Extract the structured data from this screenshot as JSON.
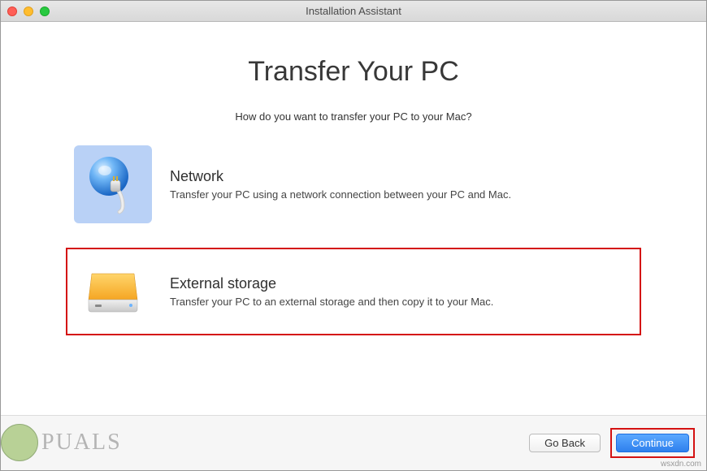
{
  "window": {
    "title": "Installation Assistant"
  },
  "page": {
    "title": "Transfer Your PC",
    "subtitle": "How do you want to transfer your PC to your Mac?"
  },
  "options": {
    "network": {
      "title": "Network",
      "description": "Transfer your PC using a network connection between your PC and Mac."
    },
    "external": {
      "title": "External storage",
      "description": "Transfer your PC to an external storage and then copy it to your Mac."
    }
  },
  "buttons": {
    "back": "Go Back",
    "continue": "Continue"
  },
  "watermark": {
    "left": "PUALS",
    "right": "wsxdn.com"
  }
}
